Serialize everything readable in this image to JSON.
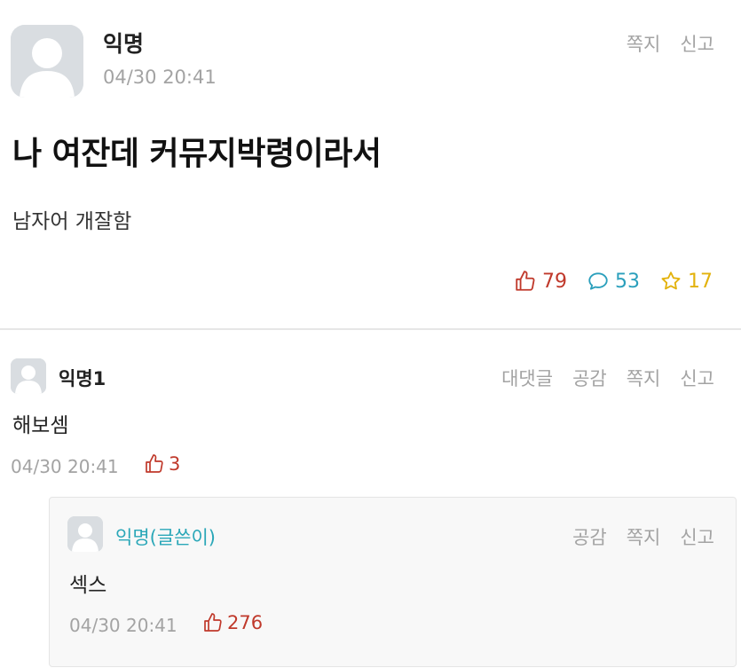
{
  "post": {
    "author": "익명",
    "date": "04/30 20:41",
    "actions": {
      "message": "쪽지",
      "report": "신고"
    },
    "title": "나 여잔데 커뮤지박령이라서",
    "body": "남자어 개잘함",
    "stats": {
      "votes": "79",
      "comments": "53",
      "scraps": "17"
    }
  },
  "comments": [
    {
      "author": "익명1",
      "text": "해보셈",
      "date": "04/30 20:41",
      "votes": "3",
      "actions": {
        "reply": "대댓글",
        "like": "공감",
        "message": "쪽지",
        "report": "신고"
      }
    }
  ],
  "child_comment": {
    "author": "익명(글쓴이)",
    "text": "섹스",
    "date": "04/30 20:41",
    "votes": "276",
    "actions": {
      "like": "공감",
      "message": "쪽지",
      "report": "신고"
    }
  },
  "colors": {
    "vote": "#c0392b",
    "comment": "#2a9fbc",
    "scrap": "#e3b20c",
    "writer": "#2aa7b8",
    "muted": "#a3a3a3"
  },
  "icons": [
    "avatar-icon",
    "thumbs-up-icon",
    "comment-bubble-icon",
    "star-icon"
  ]
}
